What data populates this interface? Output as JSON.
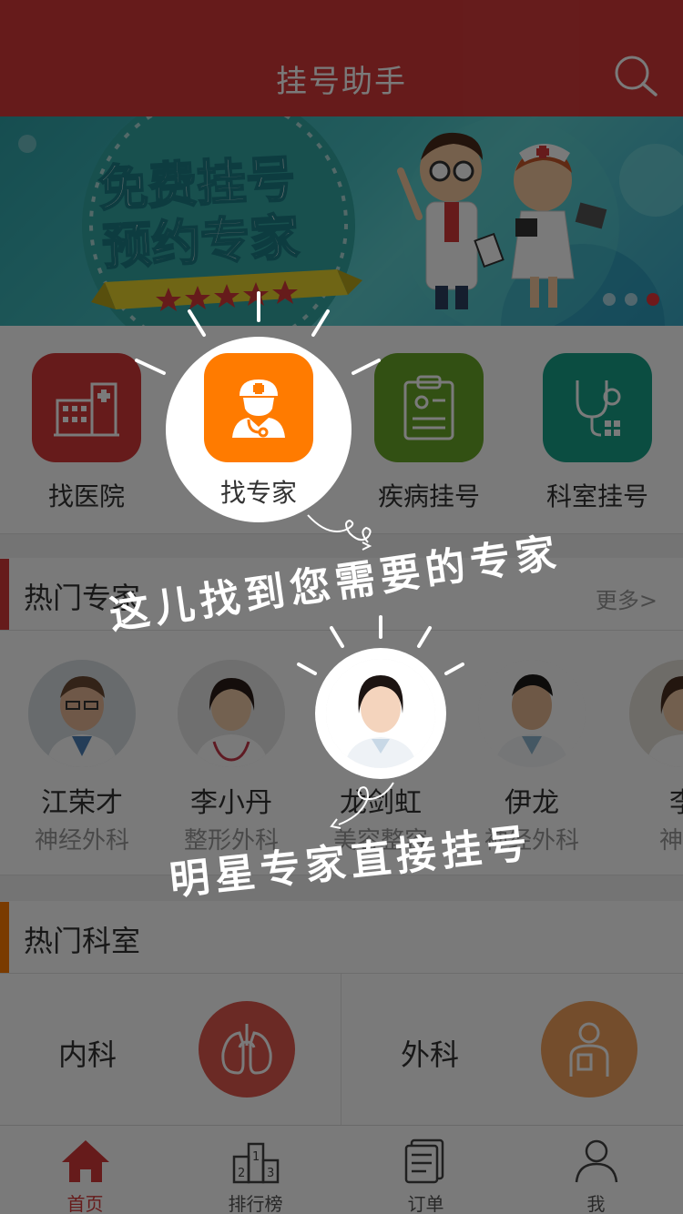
{
  "header": {
    "title": "挂号助手",
    "search_icon": "search-icon"
  },
  "banner": {
    "headline_line1": "免费挂号",
    "headline_line2": "预约专家",
    "dots": 3,
    "active_dot": 3,
    "colors": {
      "teal": "#2fa3a8",
      "ribbon": "#e8d42c"
    }
  },
  "quick_entries": [
    {
      "label": "找医院",
      "icon": "hospital-icon",
      "color": "#d63a3a"
    },
    {
      "label": "找专家",
      "icon": "doctor-icon",
      "color": "#ff7b00"
    },
    {
      "label": "疾病挂号",
      "icon": "clipboard-icon",
      "color": "#6aa728"
    },
    {
      "label": "科室挂号",
      "icon": "stethoscope-icon",
      "color": "#17a289"
    }
  ],
  "hot_experts": {
    "title": "热门专家",
    "more": "更多>",
    "items": [
      {
        "name": "江荣才",
        "dept": "神经外科"
      },
      {
        "name": "李小丹",
        "dept": "整形外科"
      },
      {
        "name": "龙剑虹",
        "dept": "美容整容"
      },
      {
        "name": "伊龙",
        "dept": "神经外科"
      },
      {
        "name": "李",
        "dept": "神经"
      }
    ]
  },
  "hot_departments": {
    "title": "热门科室",
    "items": [
      {
        "name": "内科",
        "icon": "lungs-icon",
        "color": "#e0584e"
      },
      {
        "name": "外科",
        "icon": "surgeon-icon",
        "color": "#f2a25c"
      }
    ]
  },
  "tabbar": [
    {
      "label": "首页",
      "icon": "home-icon",
      "active": true
    },
    {
      "label": "排行榜",
      "icon": "podium-icon",
      "active": false
    },
    {
      "label": "订单",
      "icon": "order-icon",
      "active": false
    },
    {
      "label": "我",
      "icon": "user-icon",
      "active": false
    }
  ],
  "guide": {
    "tip_expert_search": "这儿找到您需要的专家",
    "tip_star_expert": "明星专家直接挂号"
  },
  "colors": {
    "brand": "#d63a3a",
    "accent": "#ff7b00"
  }
}
